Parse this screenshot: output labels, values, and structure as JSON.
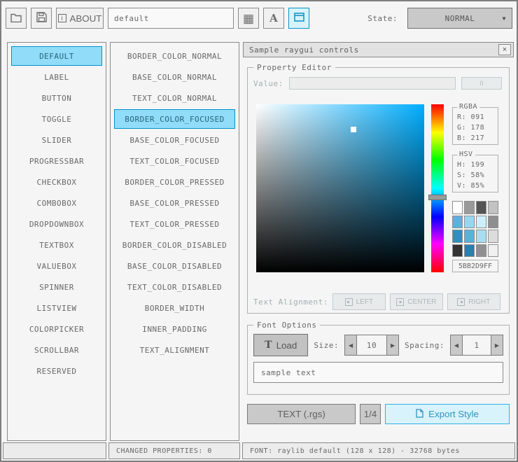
{
  "toolbar": {
    "about_label": "ABOUT",
    "about_icon_glyph": "i",
    "style_name_value": "default",
    "state_label": "State:",
    "state_value": "NORMAL"
  },
  "icons": {
    "grid": "▦",
    "font": "A",
    "dropdown_arrow": "▼",
    "close": "×",
    "spin_left": "◀",
    "spin_right": "▶",
    "load_t": "T"
  },
  "lists": {
    "controls": [
      "DEFAULT",
      "LABEL",
      "BUTTON",
      "TOGGLE",
      "SLIDER",
      "PROGRESSBAR",
      "CHECKBOX",
      "COMBOBOX",
      "DROPDOWNBOX",
      "TEXTBOX",
      "VALUEBOX",
      "SPINNER",
      "LISTVIEW",
      "COLORPICKER",
      "SCROLLBAR",
      "RESERVED"
    ],
    "controls_selected": "DEFAULT",
    "properties": [
      "BORDER_COLOR_NORMAL",
      "BASE_COLOR_NORMAL",
      "TEXT_COLOR_NORMAL",
      "BORDER_COLOR_FOCUSED",
      "BASE_COLOR_FOCUSED",
      "TEXT_COLOR_FOCUSED",
      "BORDER_COLOR_PRESSED",
      "BASE_COLOR_PRESSED",
      "TEXT_COLOR_PRESSED",
      "BORDER_COLOR_DISABLED",
      "BASE_COLOR_DISABLED",
      "TEXT_COLOR_DISABLED",
      "BORDER_WIDTH",
      "INNER_PADDING",
      "TEXT_ALIGNMENT"
    ],
    "properties_selected": "BORDER_COLOR_FOCUSED"
  },
  "panel": {
    "title": "Sample raygui controls",
    "property_editor": {
      "label": "Property Editor",
      "value_label": "Value:",
      "value_input": "",
      "value_button_label": "0",
      "rgba_label": "RGBA",
      "rgba_r": "R: 091",
      "rgba_g": "G: 178",
      "rgba_b": "B: 217",
      "hsv_label": "HSV",
      "hsv_h": "H: 199",
      "hsv_s": "S: 58%",
      "hsv_v": "V: 85%",
      "hex_value": "5BB2D9FF",
      "selected_color": "#5BB2D9",
      "swatches": [
        "#ffffff",
        "#9a9a9a",
        "#545454",
        "#c2c2c2",
        "#5bb2d9",
        "#97d8f0",
        "#cdeffc",
        "#8f8f8f",
        "#2f90c0",
        "#5bb2d9",
        "#a8def2",
        "#dcdcdc",
        "#333333",
        "#2a7fae",
        "#909090",
        "#f0f0f0"
      ],
      "alignment_label": "Text Alignment:",
      "align_left": "LEFT",
      "align_center": "CENTER",
      "align_right": "RIGHT"
    },
    "font_options": {
      "label": "Font Options",
      "load_label": "Load",
      "size_label": "Size:",
      "size_value": "10",
      "spacing_label": "Spacing:",
      "spacing_value": "1",
      "sample_text": "sample text"
    },
    "footer": {
      "text_rgs_label": "TEXT (.rgs)",
      "pages_label": "1/4",
      "export_label": "Export Style"
    }
  },
  "statusbar": {
    "changed_properties": "CHANGED PROPERTIES: 0",
    "font_info": "FONT: raylib default (128 x 128) - 32768 bytes"
  },
  "colors": {
    "accent": "#0492c7",
    "accent_bg": "#91dcf8",
    "focus_border": "#30b2e6",
    "focus_bg": "#d9f3fc",
    "text": "#686868",
    "border": "#838383",
    "hue": "#00aeff"
  }
}
